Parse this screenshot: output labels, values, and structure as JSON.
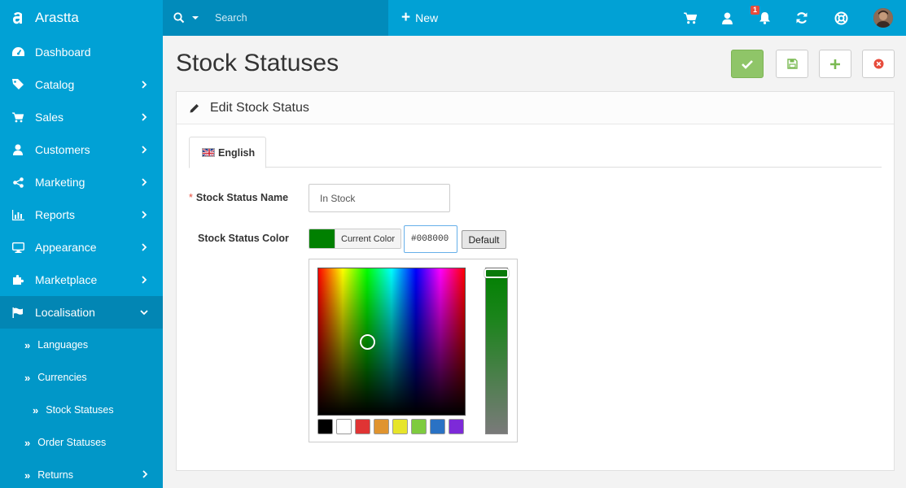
{
  "brand": {
    "name": "Arastta"
  },
  "sidebar": {
    "items": [
      {
        "label": "Dashboard",
        "icon": "dashboard-icon"
      },
      {
        "label": "Catalog",
        "icon": "tags-icon"
      },
      {
        "label": "Sales",
        "icon": "cart-icon"
      },
      {
        "label": "Customers",
        "icon": "user-icon"
      },
      {
        "label": "Marketing",
        "icon": "share-icon"
      },
      {
        "label": "Reports",
        "icon": "bar-chart-icon"
      },
      {
        "label": "Appearance",
        "icon": "desktop-icon"
      },
      {
        "label": "Marketplace",
        "icon": "puzzle-icon"
      },
      {
        "label": "Localisation",
        "icon": "flag-icon"
      }
    ],
    "sub_items": [
      {
        "label": "Languages"
      },
      {
        "label": "Currencies"
      },
      {
        "label": "Stock Statuses"
      },
      {
        "label": "Order Statuses"
      },
      {
        "label": "Returns"
      }
    ]
  },
  "header": {
    "search_placeholder": "Search",
    "new_label": "New",
    "notification_count": "1"
  },
  "page": {
    "title": "Stock Statuses",
    "panel_title": "Edit Stock Status"
  },
  "form": {
    "tab_label": "English",
    "name_label": "Stock Status Name",
    "name_value": "In Stock",
    "color_label": "Stock Status Color",
    "current_color_label": "Current Color",
    "color_value": "#008000",
    "default_label": "Default"
  },
  "colors": {
    "sidebar": "#01a1d5",
    "current_color": "#008000",
    "presets": [
      "#000000",
      "#ffffff",
      "#e03434",
      "#e0942f",
      "#e7e52a",
      "#7ecb3f",
      "#2a72c4",
      "#7d2ad8"
    ]
  }
}
